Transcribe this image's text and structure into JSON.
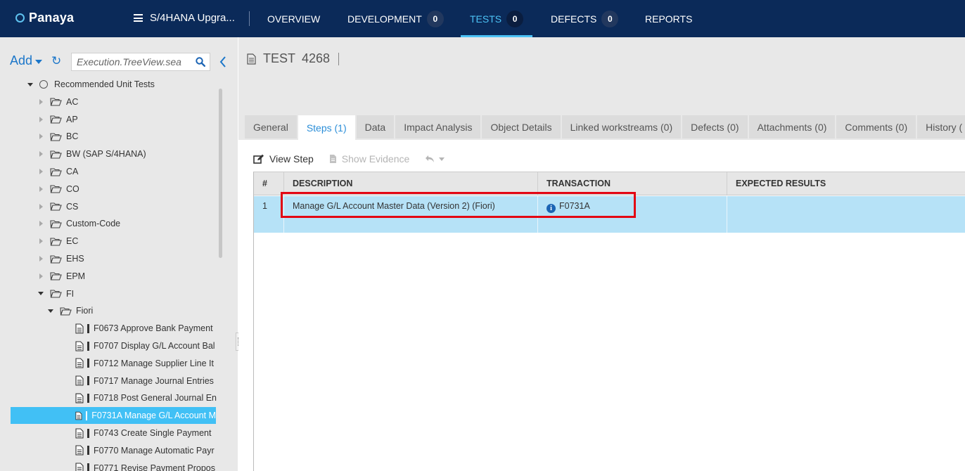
{
  "brand": {
    "name": "Panaya"
  },
  "project": {
    "name": "S/4HANA Upgra..."
  },
  "nav": [
    {
      "label": "OVERVIEW"
    },
    {
      "label": "DEVELOPMENT",
      "badge": "0"
    },
    {
      "label": "TESTS",
      "badge": "0",
      "active": true
    },
    {
      "label": "DEFECTS",
      "badge": "0"
    },
    {
      "label": "REPORTS"
    }
  ],
  "sidebar": {
    "add_label": "Add",
    "search_placeholder": "Execution.TreeView.sea",
    "tree": [
      {
        "label": "Recommended Unit Tests",
        "type": "root"
      },
      {
        "label": "AC",
        "type": "folder"
      },
      {
        "label": "AP",
        "type": "folder"
      },
      {
        "label": "BC",
        "type": "folder"
      },
      {
        "label": "BW (SAP S/4HANA)",
        "type": "folder"
      },
      {
        "label": "CA",
        "type": "folder"
      },
      {
        "label": "CO",
        "type": "folder"
      },
      {
        "label": "CS",
        "type": "folder"
      },
      {
        "label": "Custom-Code",
        "type": "folder"
      },
      {
        "label": "EC",
        "type": "folder"
      },
      {
        "label": "EHS",
        "type": "folder"
      },
      {
        "label": "EPM",
        "type": "folder"
      },
      {
        "label": "FI",
        "type": "folder-open"
      },
      {
        "label": "Fiori",
        "type": "folder-open"
      },
      {
        "label": "F0673 Approve Bank Payment",
        "type": "doc"
      },
      {
        "label": "F0707 Display G/L Account Bal",
        "type": "doc"
      },
      {
        "label": "F0712 Manage Supplier Line It",
        "type": "doc"
      },
      {
        "label": "F0717 Manage Journal Entries",
        "type": "doc"
      },
      {
        "label": "F0718 Post General Journal En",
        "type": "doc"
      },
      {
        "label": "F0731A Manage G/L Account M",
        "type": "doc",
        "selected": true
      },
      {
        "label": "F0743 Create Single Payment",
        "type": "doc"
      },
      {
        "label": "F0770 Manage Automatic Payr",
        "type": "doc"
      },
      {
        "label": "F0771 Revise Payment Propos",
        "type": "doc"
      }
    ]
  },
  "test": {
    "prefix": "TEST",
    "number": "4268"
  },
  "tabs": [
    {
      "label": "General"
    },
    {
      "label": "Steps (1)",
      "active": true
    },
    {
      "label": "Data"
    },
    {
      "label": "Impact Analysis"
    },
    {
      "label": "Object Details"
    },
    {
      "label": "Linked workstreams (0)"
    },
    {
      "label": "Defects (0)"
    },
    {
      "label": "Attachments (0)"
    },
    {
      "label": "Comments (0)"
    },
    {
      "label": "History ("
    }
  ],
  "toolbar": {
    "view_step": "View Step",
    "show_evidence": "Show Evidence"
  },
  "grid": {
    "headers": {
      "num": "#",
      "description": "DESCRIPTION",
      "transaction": "TRANSACTION",
      "expected": "EXPECTED RESULTS"
    },
    "rows": [
      {
        "num": "1",
        "description": "Manage G/L Account Master Data (Version 2) (Fiori)",
        "transaction": "F0731A",
        "expected": ""
      }
    ]
  },
  "colors": {
    "topbar": "#0b2a59",
    "accent": "#4cc2f5",
    "selected_row": "#b6e2f7",
    "highlight": "#e30613"
  }
}
